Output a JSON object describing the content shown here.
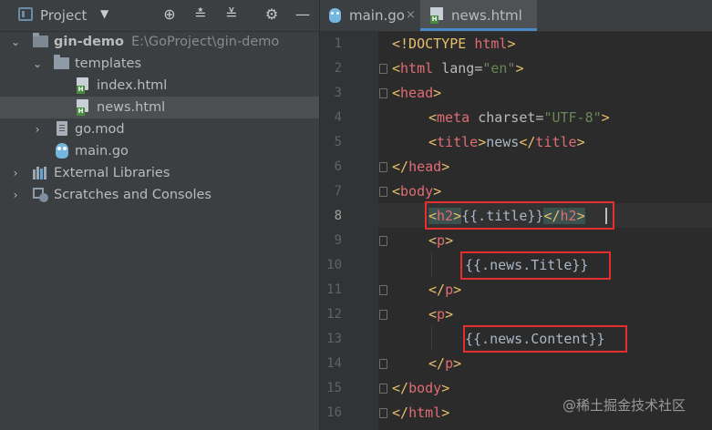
{
  "project_panel": {
    "title": "Project",
    "dropdown_icon": "caret-down-icon",
    "toolbar_icons": [
      "locate-icon",
      "expand-all-icon",
      "collapse-all-icon",
      "gear-icon",
      "minimize-icon"
    ],
    "root": {
      "name": "gin-demo",
      "path": "E:\\GoProject\\gin-demo"
    },
    "templates_folder": "templates",
    "files": {
      "index": "index.html",
      "news": "news.html",
      "gomod": "go.mod",
      "main": "main.go"
    },
    "external_libraries": "External Libraries",
    "scratches": "Scratches and Consoles"
  },
  "tabs": [
    {
      "label": "main.go",
      "close": "×"
    },
    {
      "label": "news.html",
      "close": ""
    }
  ],
  "editor": {
    "line_numbers": [
      "1",
      "2",
      "3",
      "4",
      "5",
      "6",
      "7",
      "8",
      "9",
      "10",
      "11",
      "12",
      "13",
      "14",
      "15",
      "16"
    ],
    "current_line": "8",
    "code": {
      "l1a": "<!DOCTYPE ",
      "l1b": "html",
      "l1c": ">",
      "l2a": "<",
      "l2b": "html ",
      "l2c": "lang",
      "l2d": "=",
      "l2e": "\"en\"",
      "l2f": ">",
      "l3a": "<",
      "l3b": "head",
      "l3c": ">",
      "l4a": "<",
      "l4b": "meta ",
      "l4c": "charset",
      "l4d": "=",
      "l4e": "\"UTF-8\"",
      "l4f": ">",
      "l5a": "<",
      "l5b": "title",
      "l5c": ">",
      "l5d": "news",
      "l5e": "</",
      "l5f": "title",
      "l5g": ">",
      "l6a": "</",
      "l6b": "head",
      "l6c": ">",
      "l7a": "<",
      "l7b": "body",
      "l7c": ">",
      "l8a": "<",
      "l8b": "h2",
      "l8c": ">",
      "l8d": "{{.title}}",
      "l8e": "</",
      "l8f": "h2",
      "l8g": ">",
      "l9a": "<",
      "l9b": "p",
      "l9c": ">",
      "l10": "{{.news.Title}}",
      "l11a": "</",
      "l11b": "p",
      "l11c": ">",
      "l12a": "<",
      "l12b": "p",
      "l12c": ">",
      "l13": "{{.news.Content}}",
      "l14a": "</",
      "l14b": "p",
      "l14c": ">",
      "l15a": "</",
      "l15b": "body",
      "l15c": ">",
      "l16a": "</",
      "l16b": "html",
      "l16c": ">"
    }
  },
  "watermark": "@稀土掘金技术社区"
}
